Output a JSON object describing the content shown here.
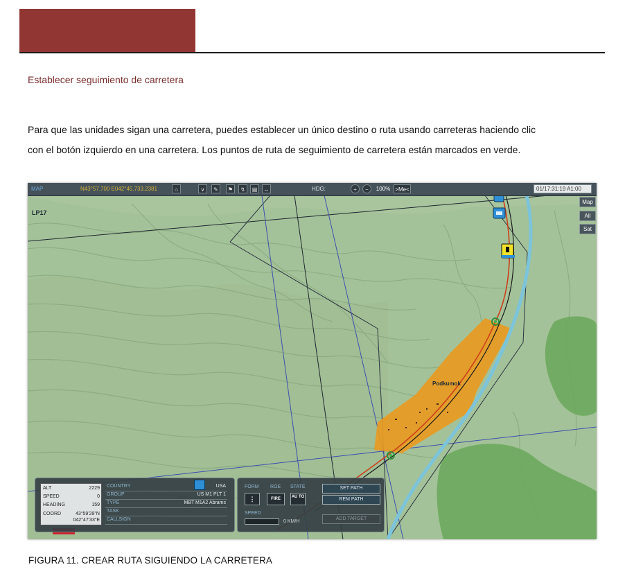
{
  "document": {
    "section_title": "Establecer seguimiento de carretera",
    "paragraph_lines": [
      "Para que las unidades sigan una carretera, puedes establecer un único destino o ruta usando carreteras haciendo clic",
      "con el botón izquierdo en una carretera. Los puntos de ruta de seguimiento de carretera están marcados en verde."
    ],
    "figure_caption": "FIGURA 11. CREAR RUTA SIGUIENDO LA CARRETERA"
  },
  "map": {
    "topbar": {
      "mode_label": "MAP",
      "coordinates": "N43°57.700 E042°45.733.2381",
      "heading_label": "HDG:",
      "zoom": "100%",
      "me_button": ">Me<",
      "time": "01/17:31:19 A1:00"
    },
    "side_buttons": [
      "Map",
      "All",
      "Sat"
    ],
    "labels": {
      "grid_square": "LP17",
      "town": "Podkumok"
    },
    "unit_stats": {
      "rows": [
        {
          "key": "ALT",
          "value": "2229"
        },
        {
          "key": "SPEED",
          "value": "0"
        },
        {
          "key": "HEADING",
          "value": "159"
        }
      ],
      "coord_key": "COORD",
      "coord_lat": "43°59'29\"N",
      "coord_lon": "042°47'33\"E"
    },
    "unit_info": [
      {
        "key": "COUNTRY",
        "value": "USA"
      },
      {
        "key": "GROUP",
        "value": "US M1 PLT 1"
      },
      {
        "key": "TYPE",
        "value": "MBT M1A2 Abrams"
      },
      {
        "key": "TASK",
        "value": ""
      },
      {
        "key": "CALLSIGN",
        "value": ""
      }
    ],
    "orders": {
      "form_label": "FORM",
      "roe_label": "ROE",
      "state_label": "STATE",
      "roe_value": "FIRE",
      "state_value": "AU TO",
      "speed_label": "SPEED",
      "speed_value": "0 KM/H",
      "set_path": "SET PATH",
      "rem_path": "REM PATH",
      "add_target": "ADD TARGET"
    },
    "colors": {
      "road": "#cc3f1a",
      "river": "#7cc4da",
      "town_area": "#e89a22",
      "waypoint": "#3fb34f",
      "forest": "#6aa85a"
    }
  }
}
